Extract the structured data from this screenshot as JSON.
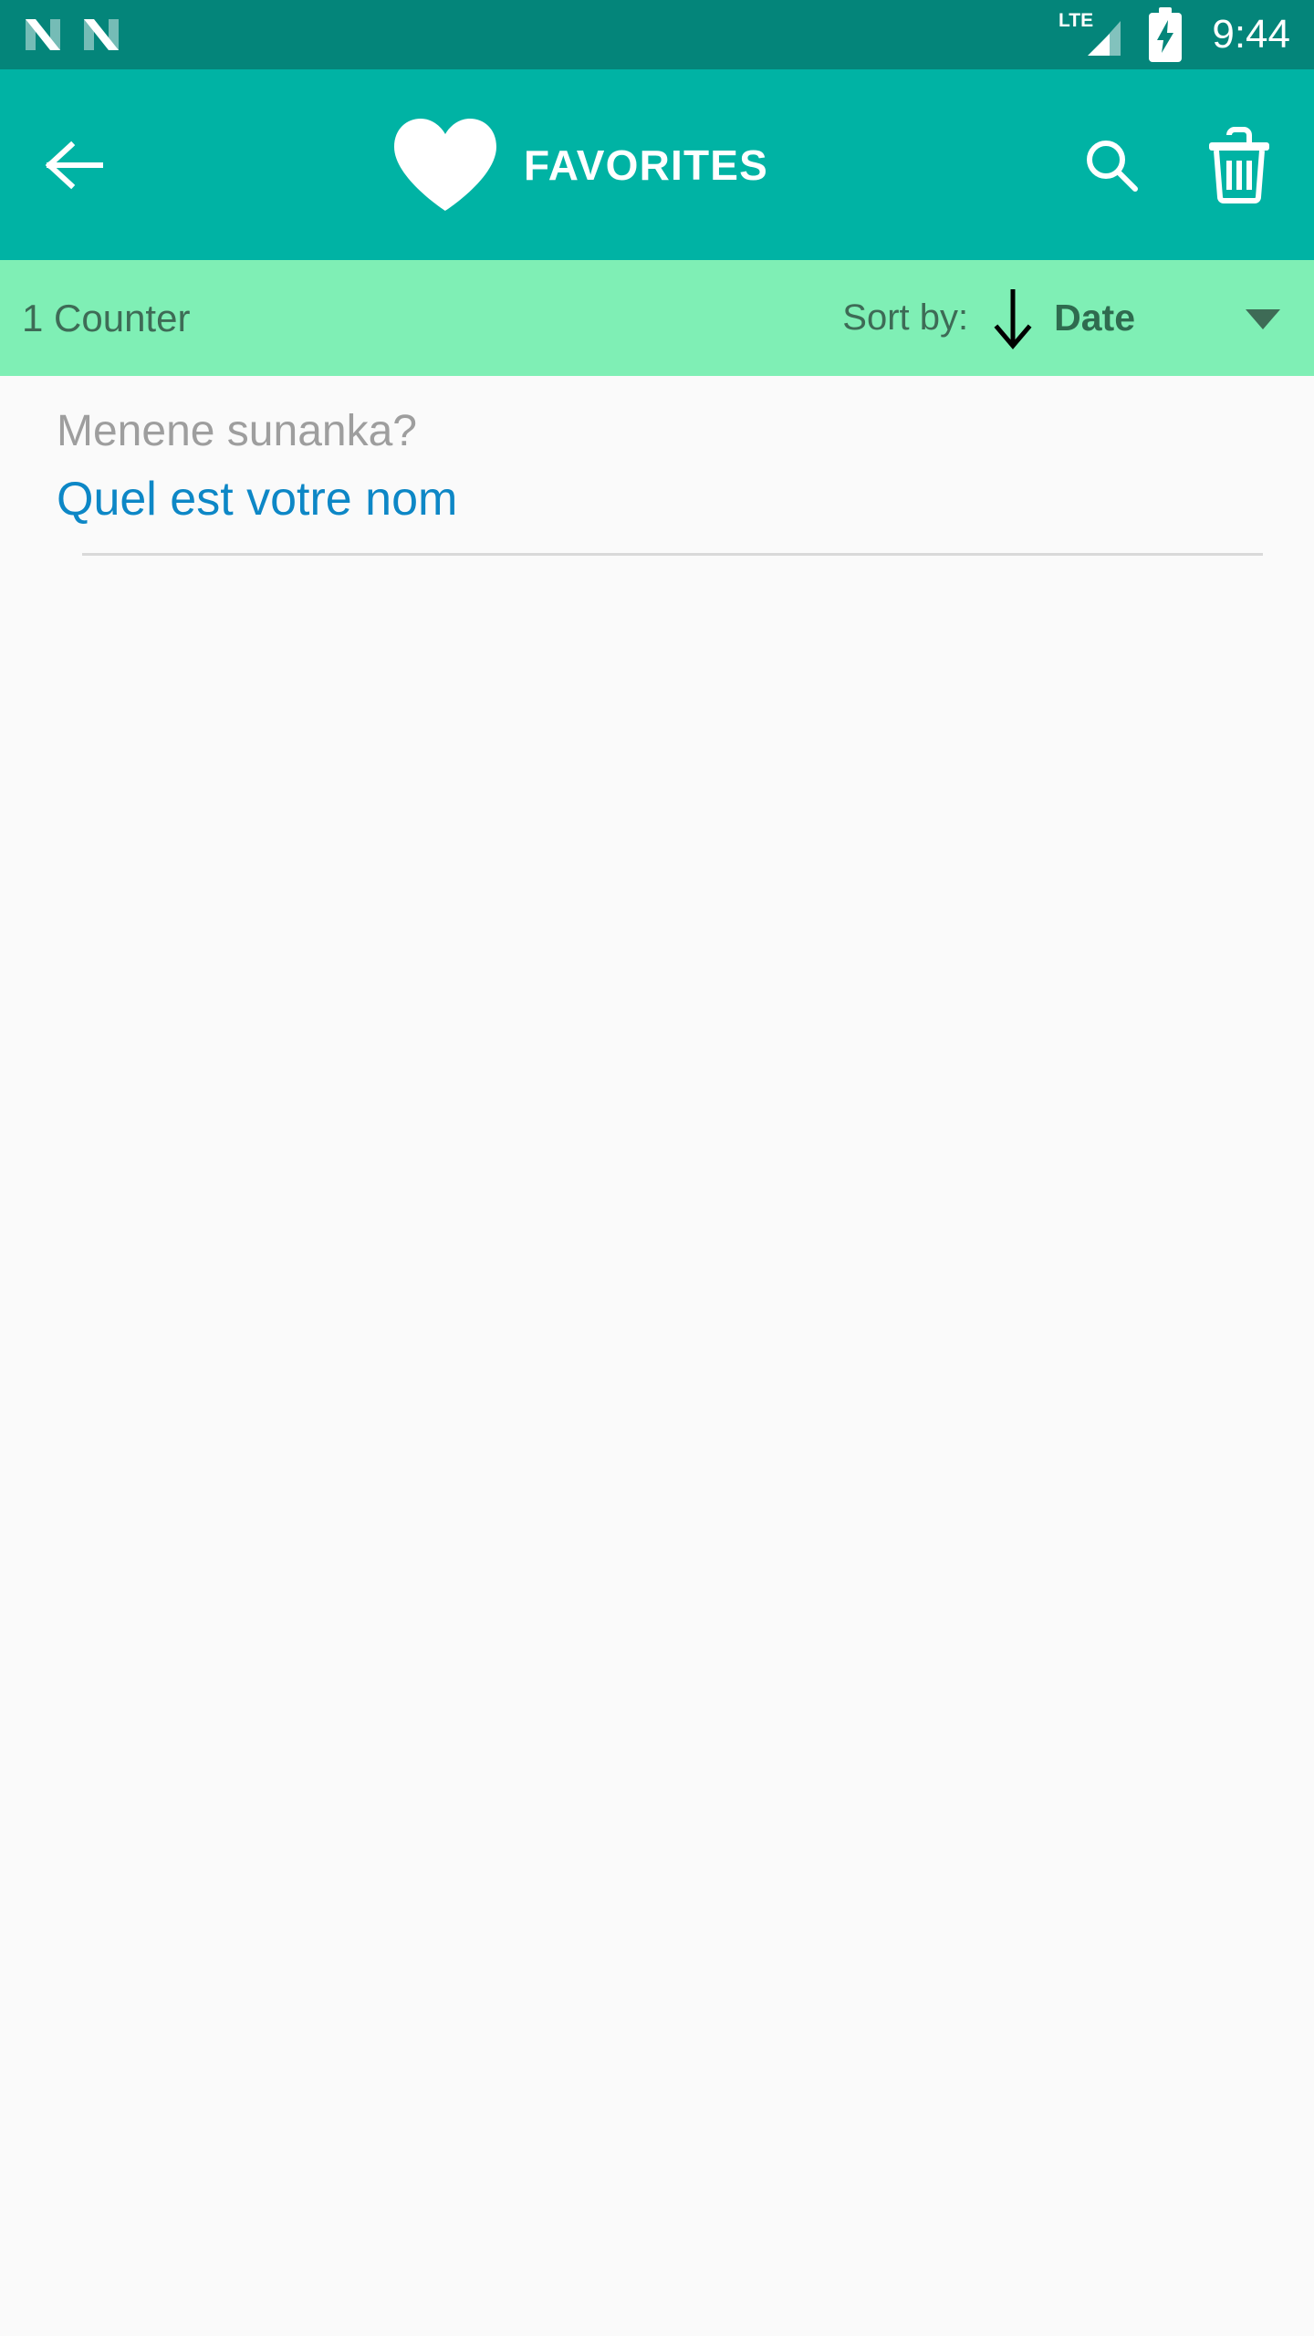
{
  "status_bar": {
    "notification_icons": [
      "nougat-n-icon",
      "nougat-n-icon"
    ],
    "network_label": "LTE",
    "signal_icon": "signal-bars-icon",
    "battery_icon": "battery-charging-icon",
    "time": "9:44",
    "background_color": "#04857A"
  },
  "app_bar": {
    "back_icon": "arrow-back-icon",
    "heart_icon": "heart-icon",
    "title": "FAVORITES",
    "search_icon": "search-icon",
    "delete_icon": "trash-icon",
    "background_color": "#00B3A4",
    "text_color": "#FFFFFF"
  },
  "sort_bar": {
    "counter_text": "1 Counter",
    "sort_by_label": "Sort by:",
    "sort_direction_icon": "arrow-down-icon",
    "sort_value": "Date",
    "dropdown_icon": "chevron-down-icon",
    "background_color": "#7FEFB5",
    "text_color": "#3E6B56"
  },
  "list": {
    "items": [
      {
        "primary": "Menene sunanka?",
        "secondary": "Quel est votre nom",
        "primary_color": "#9E9E9E",
        "secondary_color": "#0D87C6"
      }
    ]
  }
}
